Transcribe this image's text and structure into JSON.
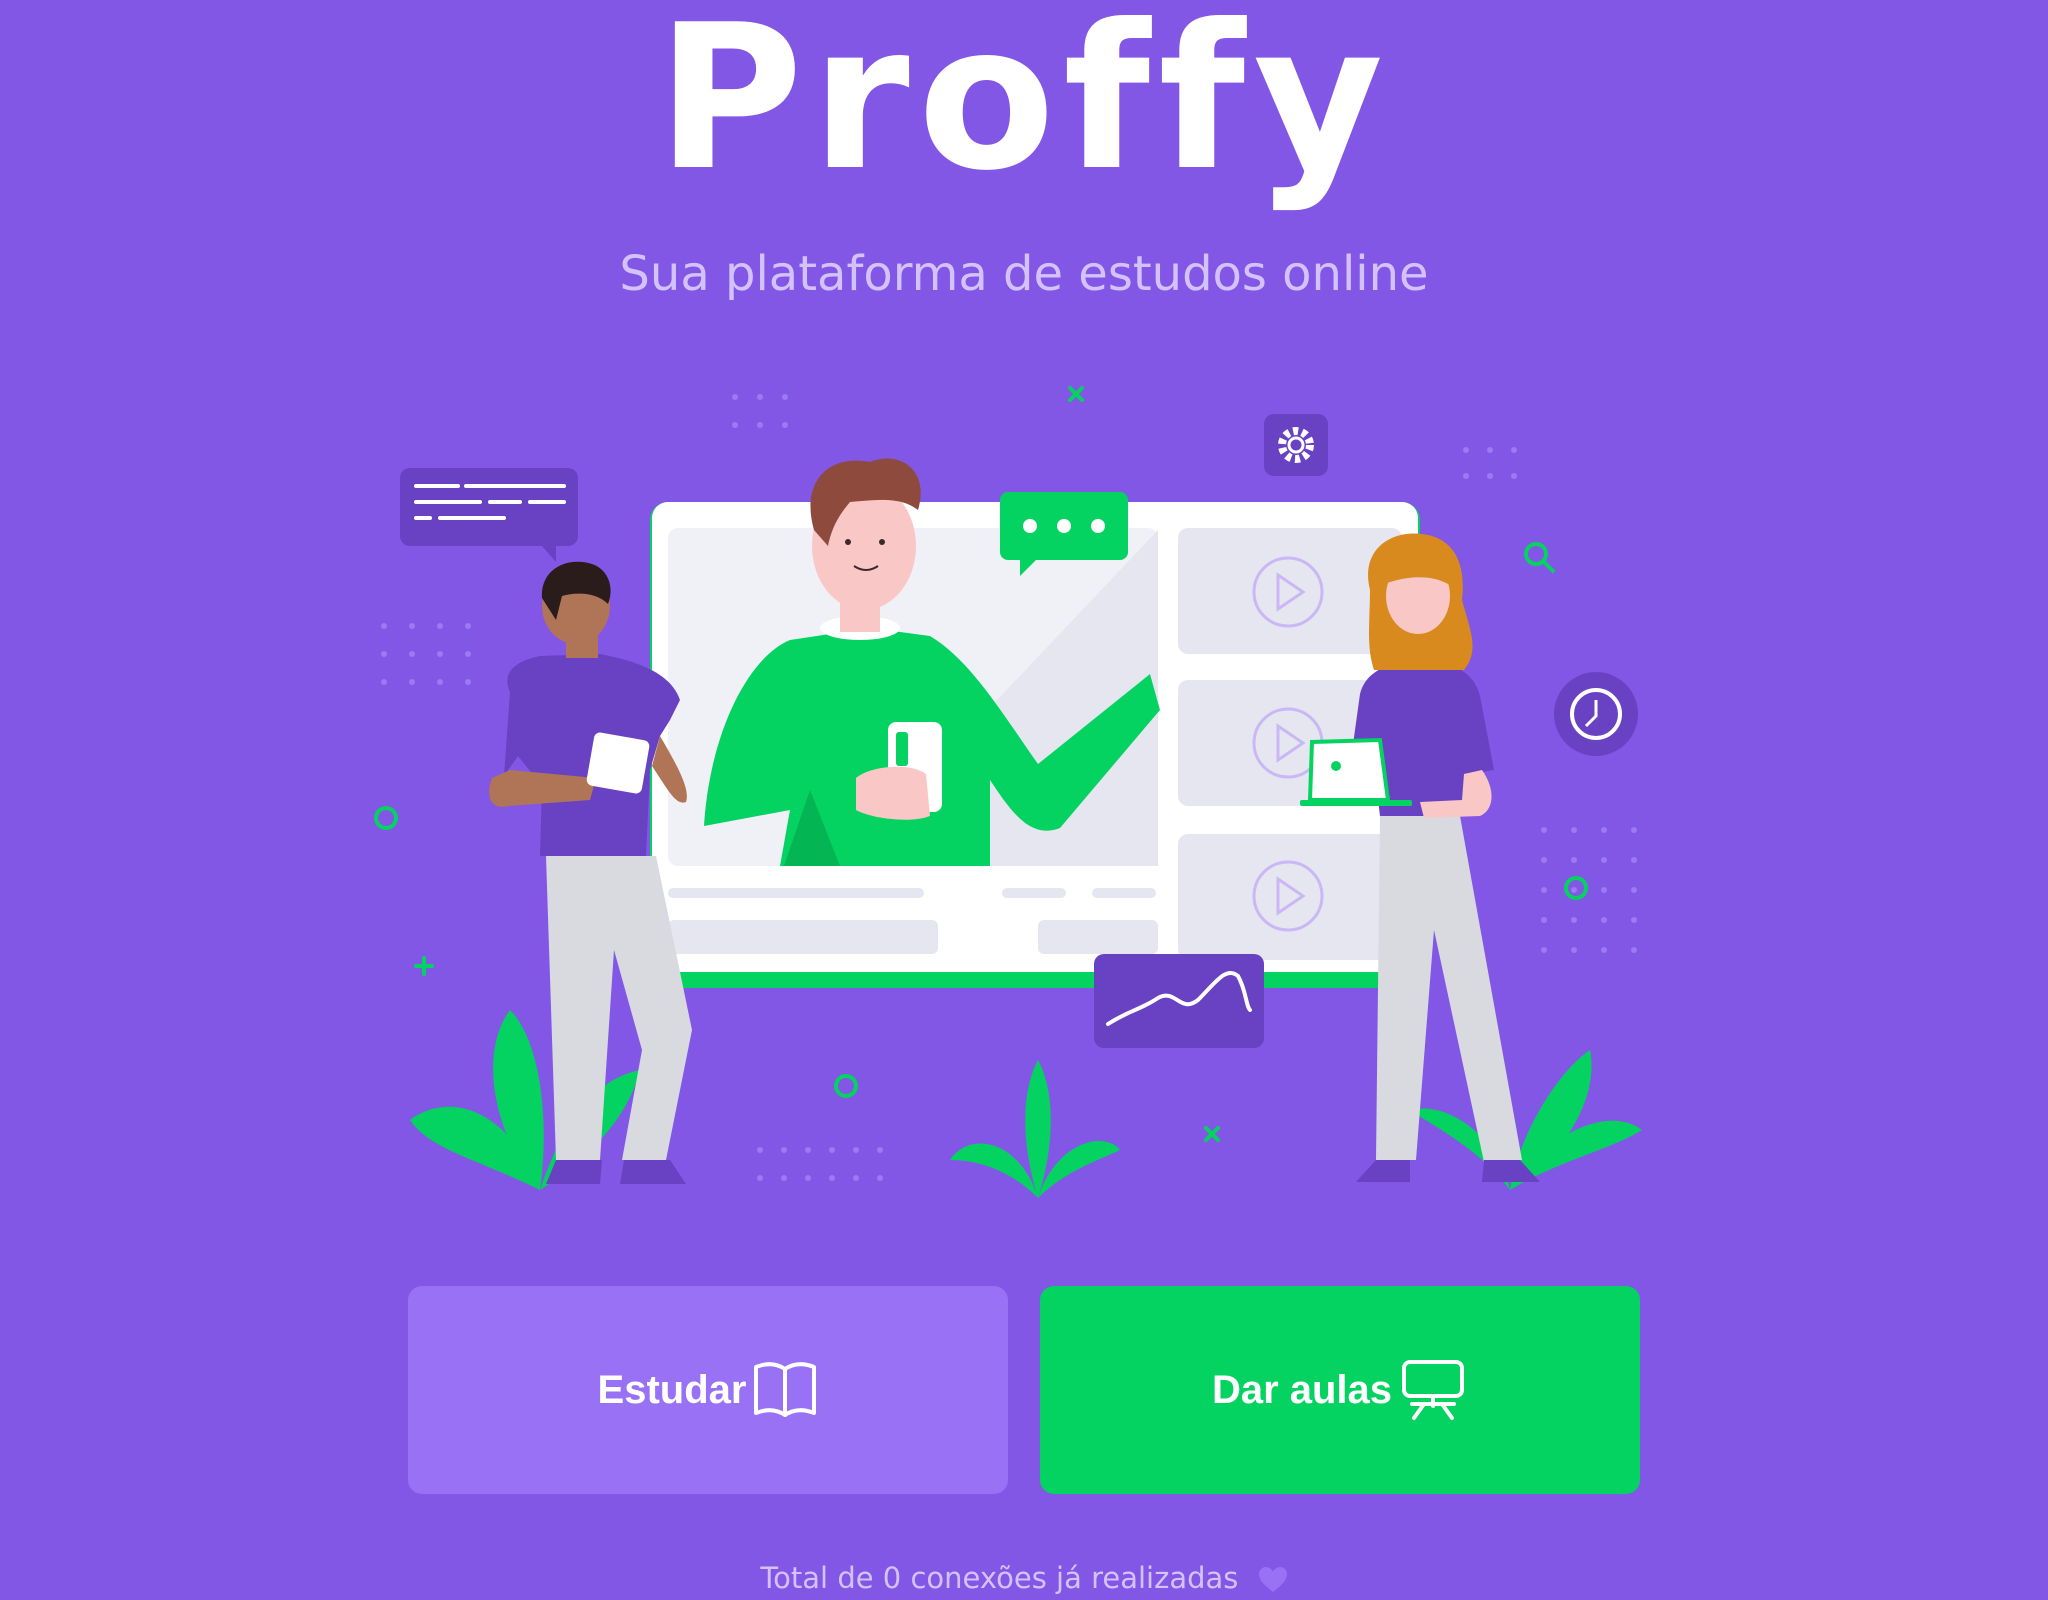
{
  "brand": {
    "logo_text": "Proffy",
    "tagline": "Sua plataforma de estudos online"
  },
  "hero": {
    "illustration": "online-class-illustration"
  },
  "actions": {
    "study_label": "Estudar",
    "study_icon": "open-book-icon",
    "give_classes_label": "Dar aulas",
    "give_classes_icon": "presentation-board-icon"
  },
  "footer": {
    "connections_text": "Total de 0 conexões já realizadas",
    "heart_icon": "heart-icon"
  },
  "colors": {
    "background": "#8257E5",
    "primary_light": "#9871F5",
    "secondary": "#04D361",
    "text_light": "#D4C2FF"
  }
}
